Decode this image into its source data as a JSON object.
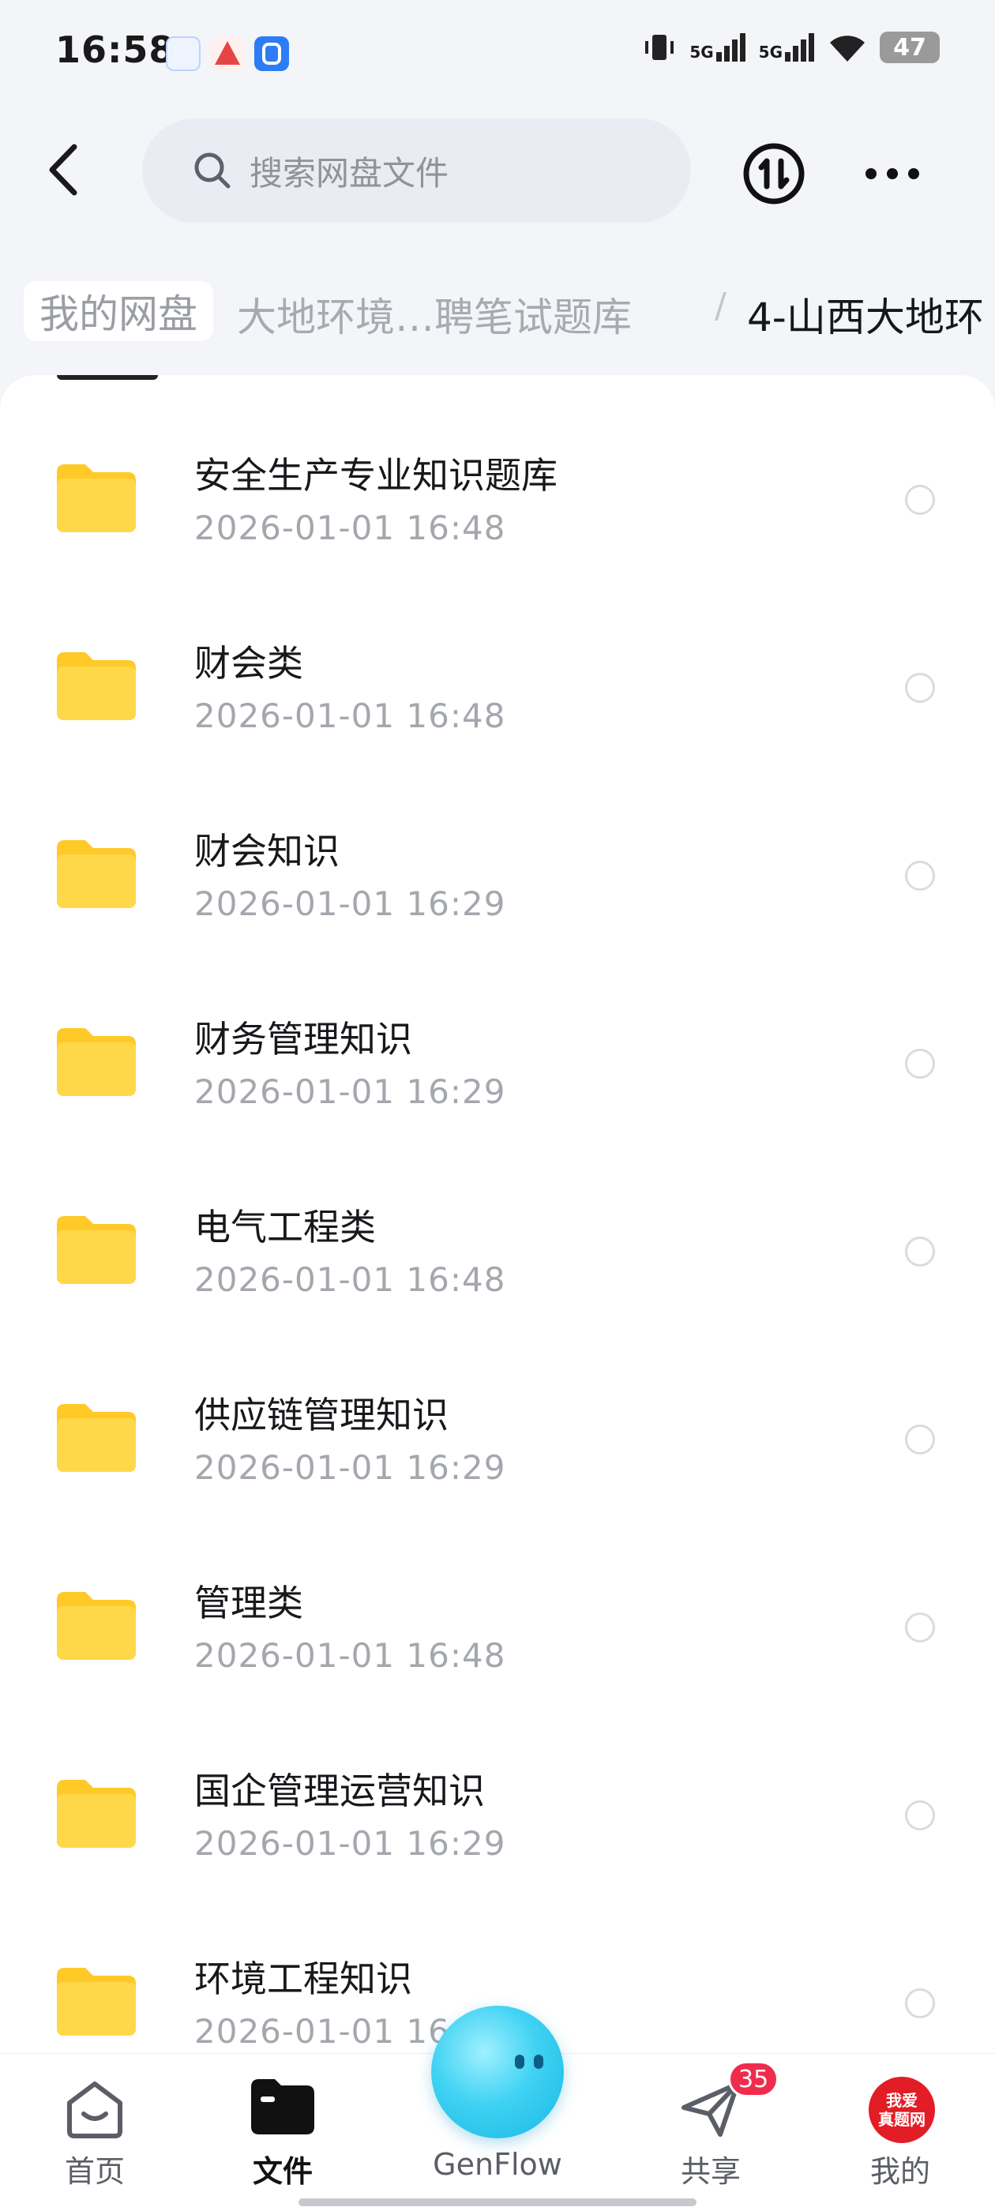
{
  "status_bar": {
    "time": "16:58",
    "signal_1": "5G",
    "signal_2": "5G",
    "battery": "47"
  },
  "header": {
    "search_placeholder": "搜索网盘文件"
  },
  "breadcrumb": {
    "root": "我的网盘",
    "middle": "大地环境…聘笔试题库",
    "separator": "/",
    "current": "4-山西大地环"
  },
  "files": [
    {
      "name": "安全生产专业知识题库",
      "date": "2026-01-01  16:48"
    },
    {
      "name": "财会类",
      "date": "2026-01-01  16:48"
    },
    {
      "name": "财会知识",
      "date": "2026-01-01  16:29"
    },
    {
      "name": "财务管理知识",
      "date": "2026-01-01  16:29"
    },
    {
      "name": "电气工程类",
      "date": "2026-01-01  16:48"
    },
    {
      "name": "供应链管理知识",
      "date": "2026-01-01  16:29"
    },
    {
      "name": "管理类",
      "date": "2026-01-01  16:48"
    },
    {
      "name": "国企管理运营知识",
      "date": "2026-01-01  16:29"
    },
    {
      "name": "环境工程知识",
      "date": "2026-01-01  16:"
    }
  ],
  "bottom_nav": {
    "home": "首页",
    "files": "文件",
    "genflow": "GenFlow",
    "share": "共享",
    "share_badge": "35",
    "me": "我的",
    "me_avatar_line1": "我爱",
    "me_avatar_line2": "真题网"
  },
  "colors": {
    "folder": "#ffc928",
    "accent_badge": "#f02c4d"
  }
}
